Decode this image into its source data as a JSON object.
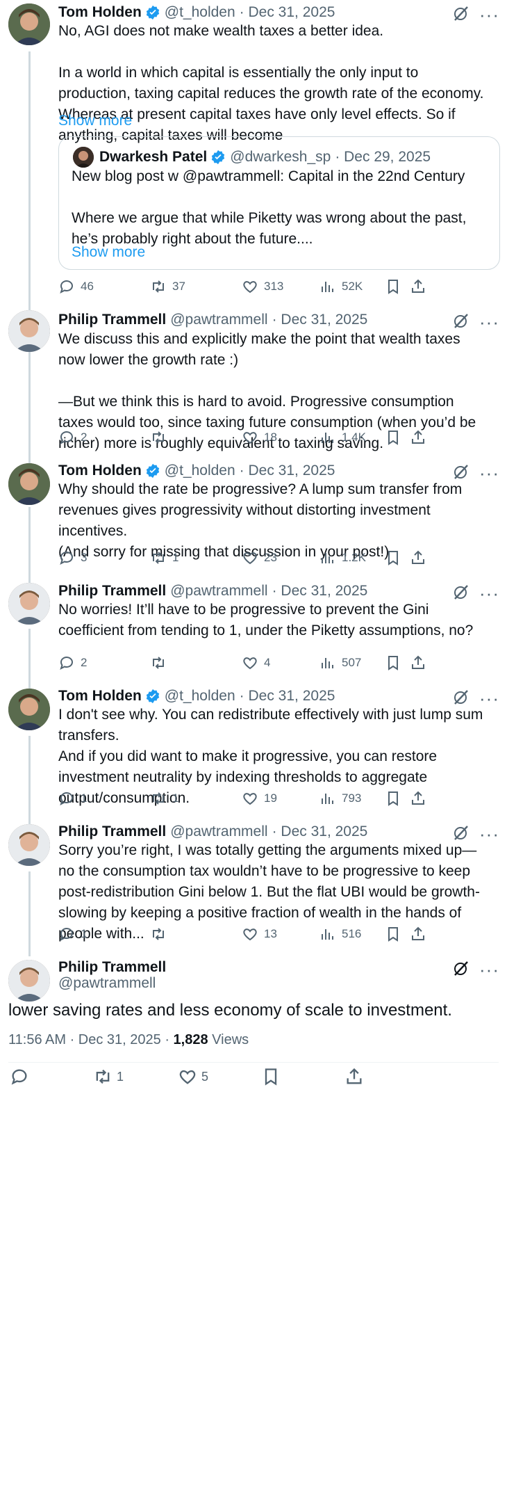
{
  "posts": [
    {
      "name": "Tom Holden",
      "verified": true,
      "handle": "@t_holden",
      "date": "· Dec 31, 2025",
      "text": "No, AGI does not make wealth taxes a better idea.\n\nIn a world in which capital is essentially the only input to production, taxing capital reduces the growth rate of the economy. Whereas at present capital taxes have only level effects. So if anything, capital taxes will become",
      "show_more": "Show more",
      "quote": {
        "name": "Dwarkesh Patel",
        "handle": "@dwarkesh_sp",
        "date": "· Dec 29, 2025",
        "text": "New blog post w @pawtrammell: Capital in the 22nd Century\n\nWhere we argue that while Piketty was wrong about the past, he’s probably right about the future....",
        "show_more": "Show more"
      },
      "replies": "46",
      "reposts": "37",
      "likes": "313",
      "views": "52K"
    },
    {
      "name": "Philip Trammell",
      "verified": false,
      "handle": "@pawtrammell",
      "date": "· Dec 31, 2025",
      "text": "We discuss this and explicitly make the point that wealth taxes now lower the growth rate :)\n\n—But we think this is hard to avoid. Progressive consumption taxes would too, since taxing future consumption (when you’d be richer) more is roughly equivalent to taxing saving.",
      "replies": "2",
      "reposts": "",
      "likes": "18",
      "views": "1.4K"
    },
    {
      "name": "Tom Holden",
      "verified": true,
      "handle": "@t_holden",
      "date": "· Dec 31, 2025",
      "text": "Why should the rate be progressive? A lump sum transfer from revenues gives progressivity without distorting investment incentives.\n(And sorry for missing that discussion in your post!)",
      "replies": "3",
      "reposts": "1",
      "likes": "23",
      "views": "1.2K"
    },
    {
      "name": "Philip Trammell",
      "verified": false,
      "handle": "@pawtrammell",
      "date": "· Dec 31, 2025",
      "text": "No worries! It’ll have to be progressive to prevent the Gini coefficient from tending to 1, under the Piketty assumptions, no?",
      "replies": "2",
      "reposts": "",
      "likes": "4",
      "views": "507"
    },
    {
      "name": "Tom Holden",
      "verified": true,
      "handle": "@t_holden",
      "date": "· Dec 31, 2025",
      "text": "I don't see why. You can redistribute effectively with just lump sum transfers.\nAnd if you did want to make it progressive, you can restore investment neutrality by indexing thresholds to aggregate output/consumption.",
      "replies": "1",
      "reposts": "1",
      "likes": "19",
      "views": "793"
    },
    {
      "name": "Philip Trammell",
      "verified": false,
      "handle": "@pawtrammell",
      "date": "· Dec 31, 2025",
      "text": "Sorry you’re right, I was totally getting the arguments mixed up—no the consumption tax wouldn’t have to be progressive to keep post-redistribution Gini below 1. But the flat UBI would be growth-slowing by keeping a positive fraction of wealth in the hands of people with...",
      "replies": "1",
      "reposts": "",
      "likes": "13",
      "views": "516"
    }
  ],
  "main": {
    "name": "Philip Trammell",
    "handle": "@pawtrammell",
    "text": "lower saving rates and less economy of scale to investment.",
    "time": "11:56 AM · Dec 31, 2025 · ",
    "views_count": "1,828",
    "views_label": " Views",
    "replies": "",
    "reposts": "1",
    "likes": "5"
  },
  "colors": {
    "accent": "#1d9bf0",
    "secondary": "#536471",
    "line": "#cfd9de"
  },
  "icons": [
    "verified-badge-icon",
    "grok-icon",
    "more-icon",
    "reply-icon",
    "repost-icon",
    "like-icon",
    "views-icon",
    "bookmark-icon",
    "share-icon"
  ]
}
